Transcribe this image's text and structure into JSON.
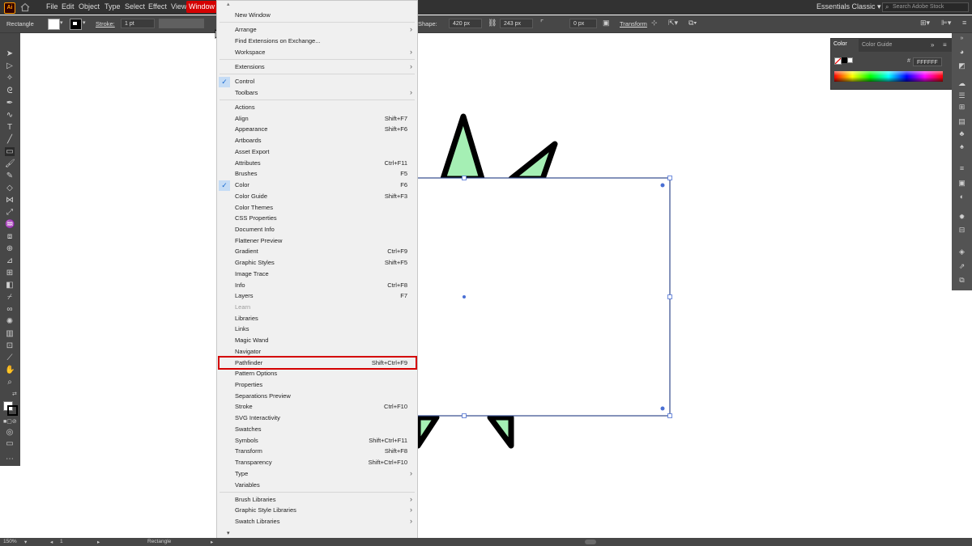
{
  "app": {
    "icon_text": "Ai",
    "workspace": "Essentials Classic",
    "search_placeholder": "Search Adobe Stock"
  },
  "menubar": {
    "items": [
      "File",
      "Edit",
      "Object",
      "Type",
      "Select",
      "Effect",
      "View",
      "Window"
    ]
  },
  "controlbar": {
    "tool_name": "Rectangle",
    "stroke_label": "Stroke:",
    "stroke_value": "1 pt",
    "shape_label": "Shape:",
    "width_value": "420 px",
    "height_value": "243 px",
    "corner_value": "0 px",
    "transform_label": "Transform"
  },
  "color_panel": {
    "tab_color": "Color",
    "tab_guide": "Color Guide",
    "hex": "FFFFFF"
  },
  "window_menu": {
    "items": [
      {
        "label": "New Window",
        "shortcut": "",
        "submenu": false,
        "checked": false,
        "disabled": false
      },
      {
        "label": "Arrange",
        "shortcut": "",
        "submenu": true,
        "checked": false,
        "disabled": false
      },
      {
        "label": "Find Extensions on Exchange...",
        "shortcut": "",
        "submenu": false,
        "checked": false,
        "disabled": false
      },
      {
        "label": "Workspace",
        "shortcut": "",
        "submenu": true,
        "checked": false,
        "disabled": false
      },
      {
        "label": "Extensions",
        "shortcut": "",
        "submenu": true,
        "checked": false,
        "disabled": false
      },
      {
        "label": "Control",
        "shortcut": "",
        "submenu": false,
        "checked": true,
        "disabled": false
      },
      {
        "label": "Toolbars",
        "shortcut": "",
        "submenu": true,
        "checked": false,
        "disabled": false
      },
      {
        "label": "Actions",
        "shortcut": "",
        "submenu": false,
        "checked": false,
        "disabled": false
      },
      {
        "label": "Align",
        "shortcut": "Shift+F7",
        "submenu": false,
        "checked": false,
        "disabled": false
      },
      {
        "label": "Appearance",
        "shortcut": "Shift+F6",
        "submenu": false,
        "checked": false,
        "disabled": false
      },
      {
        "label": "Artboards",
        "shortcut": "",
        "submenu": false,
        "checked": false,
        "disabled": false
      },
      {
        "label": "Asset Export",
        "shortcut": "",
        "submenu": false,
        "checked": false,
        "disabled": false
      },
      {
        "label": "Attributes",
        "shortcut": "Ctrl+F11",
        "submenu": false,
        "checked": false,
        "disabled": false
      },
      {
        "label": "Brushes",
        "shortcut": "F5",
        "submenu": false,
        "checked": false,
        "disabled": false
      },
      {
        "label": "Color",
        "shortcut": "F6",
        "submenu": false,
        "checked": true,
        "disabled": false
      },
      {
        "label": "Color Guide",
        "shortcut": "Shift+F3",
        "submenu": false,
        "checked": false,
        "disabled": false
      },
      {
        "label": "Color Themes",
        "shortcut": "",
        "submenu": false,
        "checked": false,
        "disabled": false
      },
      {
        "label": "CSS Properties",
        "shortcut": "",
        "submenu": false,
        "checked": false,
        "disabled": false
      },
      {
        "label": "Document Info",
        "shortcut": "",
        "submenu": false,
        "checked": false,
        "disabled": false
      },
      {
        "label": "Flattener Preview",
        "shortcut": "",
        "submenu": false,
        "checked": false,
        "disabled": false
      },
      {
        "label": "Gradient",
        "shortcut": "Ctrl+F9",
        "submenu": false,
        "checked": false,
        "disabled": false
      },
      {
        "label": "Graphic Styles",
        "shortcut": "Shift+F5",
        "submenu": false,
        "checked": false,
        "disabled": false
      },
      {
        "label": "Image Trace",
        "shortcut": "",
        "submenu": false,
        "checked": false,
        "disabled": false
      },
      {
        "label": "Info",
        "shortcut": "Ctrl+F8",
        "submenu": false,
        "checked": false,
        "disabled": false
      },
      {
        "label": "Layers",
        "shortcut": "F7",
        "submenu": false,
        "checked": false,
        "disabled": false
      },
      {
        "label": "Learn",
        "shortcut": "",
        "submenu": false,
        "checked": false,
        "disabled": true
      },
      {
        "label": "Libraries",
        "shortcut": "",
        "submenu": false,
        "checked": false,
        "disabled": false
      },
      {
        "label": "Links",
        "shortcut": "",
        "submenu": false,
        "checked": false,
        "disabled": false
      },
      {
        "label": "Magic Wand",
        "shortcut": "",
        "submenu": false,
        "checked": false,
        "disabled": false
      },
      {
        "label": "Navigator",
        "shortcut": "",
        "submenu": false,
        "checked": false,
        "disabled": false
      },
      {
        "label": "Pathfinder",
        "shortcut": "Shift+Ctrl+F9",
        "submenu": false,
        "checked": false,
        "disabled": false
      },
      {
        "label": "Pattern Options",
        "shortcut": "",
        "submenu": false,
        "checked": false,
        "disabled": false
      },
      {
        "label": "Properties",
        "shortcut": "",
        "submenu": false,
        "checked": false,
        "disabled": false
      },
      {
        "label": "Separations Preview",
        "shortcut": "",
        "submenu": false,
        "checked": false,
        "disabled": false
      },
      {
        "label": "Stroke",
        "shortcut": "Ctrl+F10",
        "submenu": false,
        "checked": false,
        "disabled": false
      },
      {
        "label": "SVG Interactivity",
        "shortcut": "",
        "submenu": false,
        "checked": false,
        "disabled": false
      },
      {
        "label": "Swatches",
        "shortcut": "",
        "submenu": false,
        "checked": false,
        "disabled": false
      },
      {
        "label": "Symbols",
        "shortcut": "Shift+Ctrl+F11",
        "submenu": false,
        "checked": false,
        "disabled": false
      },
      {
        "label": "Transform",
        "shortcut": "Shift+F8",
        "submenu": false,
        "checked": false,
        "disabled": false
      },
      {
        "label": "Transparency",
        "shortcut": "Shift+Ctrl+F10",
        "submenu": false,
        "checked": false,
        "disabled": false
      },
      {
        "label": "Type",
        "shortcut": "",
        "submenu": true,
        "checked": false,
        "disabled": false
      },
      {
        "label": "Variables",
        "shortcut": "",
        "submenu": false,
        "checked": false,
        "disabled": false
      },
      {
        "label": "Brush Libraries",
        "shortcut": "",
        "submenu": true,
        "checked": false,
        "disabled": false
      },
      {
        "label": "Graphic Style Libraries",
        "shortcut": "",
        "submenu": true,
        "checked": false,
        "disabled": false
      },
      {
        "label": "Swatch Libraries",
        "shortcut": "",
        "submenu": true,
        "checked": false,
        "disabled": false
      }
    ]
  },
  "statusbar": {
    "zoom": "150%",
    "artboard": "1",
    "tool": "Rectangle"
  },
  "colors": {
    "highlight": "#d40000",
    "star_fill": "#a5efb4",
    "selection": "#4a6fd4"
  }
}
